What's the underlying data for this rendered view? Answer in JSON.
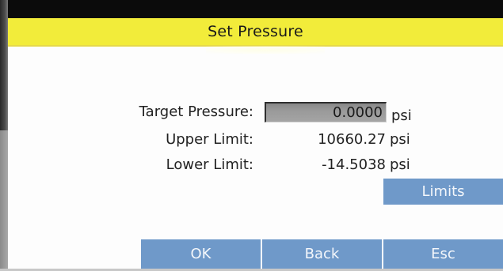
{
  "dialog": {
    "title": "Set Pressure"
  },
  "fields": {
    "target_label": "Target Pressure:",
    "target_value": "0.0000",
    "target_unit": "psi",
    "upper_label": "Upper Limit:",
    "upper_value": "10660.27",
    "upper_unit": "psi",
    "lower_label": "Lower Limit:",
    "lower_value": "-14.5038",
    "lower_unit": "psi"
  },
  "buttons": {
    "limits": "Limits",
    "ok": "OK",
    "back": "Back",
    "esc": "Esc"
  },
  "colors": {
    "title_bar": "#f2ec3a",
    "button": "#6f99c9",
    "input_bg": "#9a9a9a"
  }
}
